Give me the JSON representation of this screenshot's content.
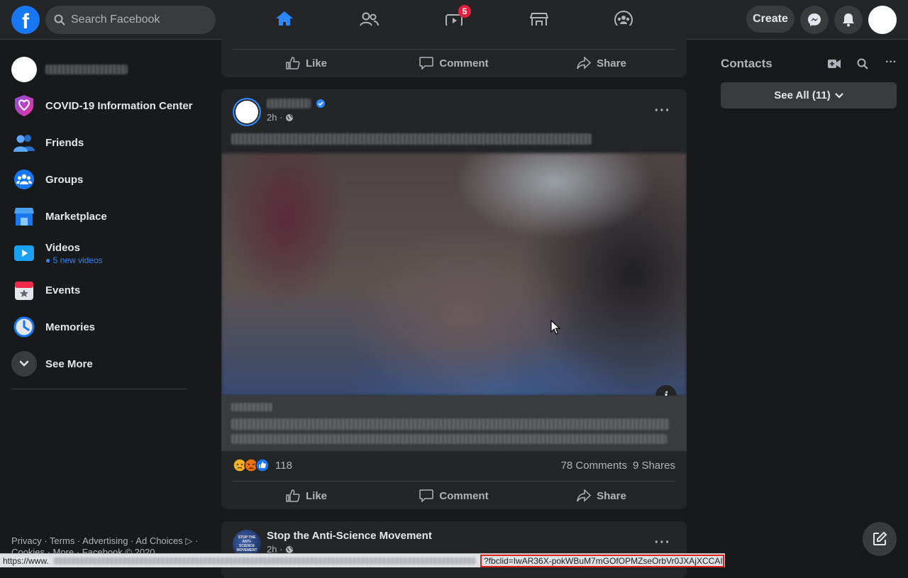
{
  "search": {
    "placeholder": "Search Facebook"
  },
  "topbar": {
    "logo": "f",
    "watch_badge": "5",
    "create_label": "Create",
    "accent_color": "#2d88ff"
  },
  "sidebar": {
    "items": [
      {
        "label": "COVID-19 Information Center",
        "icon": "covid-shield-icon"
      },
      {
        "label": "Friends",
        "icon": "friends-icon"
      },
      {
        "label": "Groups",
        "icon": "groups-icon"
      },
      {
        "label": "Marketplace",
        "icon": "marketplace-icon"
      },
      {
        "label": "Videos",
        "sub": "● 5 new videos",
        "icon": "videos-icon"
      },
      {
        "label": "Events",
        "icon": "events-icon"
      },
      {
        "label": "Memories",
        "icon": "memories-icon"
      },
      {
        "label": "See More",
        "icon": "chevron-down-icon"
      }
    ],
    "footer": "Privacy · Terms · Advertising · Ad Choices ▷ · Cookies · More · Facebook © 2020"
  },
  "feed": {
    "actions": {
      "like": "Like",
      "comment": "Comment",
      "share": "Share"
    },
    "post": {
      "time": "2h ·",
      "reaction_count": "118",
      "comments": "78 Comments",
      "shares": "9 Shares",
      "info_icon": "i"
    },
    "next_post": {
      "author": "Stop the Anti-Science Movement",
      "time": "2h ·",
      "avatar_text": "STOP THE ANTI-SCIENCE MOVEMENT"
    }
  },
  "contacts": {
    "title": "Contacts",
    "see_all": "See All (11)"
  },
  "statusbar": {
    "url_start": "https://www.",
    "url_end": "?fbclid=IwAR36X-pokWBuM7mGOfOPMZseOrbVr0JXAjXCCAI..."
  }
}
